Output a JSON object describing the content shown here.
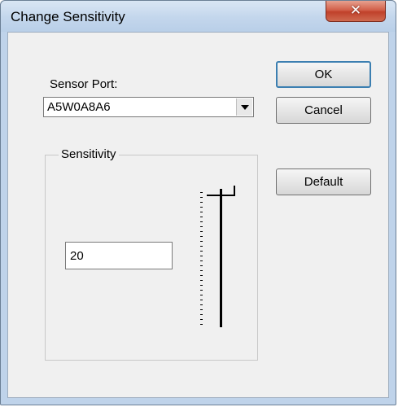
{
  "window": {
    "title": "Change Sensitivity",
    "close_glyph": "✕"
  },
  "sensor_port": {
    "label": "Sensor Port:",
    "selected_value": "A5W0A8A6"
  },
  "buttons": {
    "ok": "OK",
    "cancel": "Cancel",
    "default": "Default"
  },
  "sensitivity": {
    "group_label": "Sensitivity",
    "value": "20",
    "slider_level": "max"
  },
  "icons": {
    "close": "close-icon",
    "dropdown": "chevron-down-icon"
  },
  "colors": {
    "client_background": "#f0f0f0",
    "titlebar": "#c3d6ec",
    "close_button": "#c0412b"
  }
}
